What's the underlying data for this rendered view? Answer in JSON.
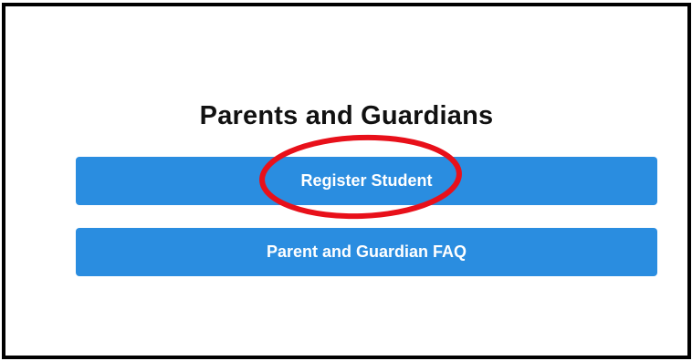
{
  "section": {
    "title": "Parents and Guardians"
  },
  "buttons": {
    "register_label": "Register Student",
    "faq_label": "Parent and Guardian FAQ"
  },
  "colors": {
    "button_bg": "#2a8de0",
    "button_text": "#ffffff",
    "highlight": "#e8101a",
    "frame_border": "#000000"
  },
  "annotation": {
    "shape": "ellipse",
    "target": "register-student-button"
  }
}
